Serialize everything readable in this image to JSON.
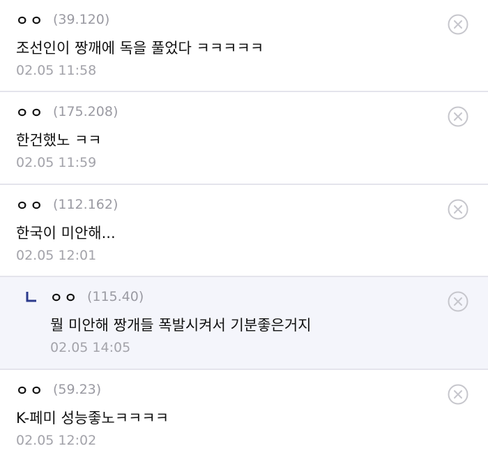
{
  "comments": [
    {
      "nickname": "ㅇㅇ",
      "ip": "(39.120)",
      "text": "조선인이 짱깨에 독을 풀었다 ㅋㅋㅋㅋㅋ",
      "date": "02.05 11:58",
      "is_reply": false
    },
    {
      "nickname": "ㅇㅇ",
      "ip": "(175.208)",
      "text": "한건했노 ㅋㅋ",
      "date": "02.05 11:59",
      "is_reply": false
    },
    {
      "nickname": "ㅇㅇ",
      "ip": "(112.162)",
      "text": "한국이 미안해...",
      "date": "02.05 12:01",
      "is_reply": false
    },
    {
      "nickname": "ㅇㅇ",
      "ip": "(115.40)",
      "text": "뭘 미안해 짱개들 폭발시켜서 기분좋은거지",
      "date": "02.05 14:05",
      "is_reply": true
    },
    {
      "nickname": "ㅇㅇ",
      "ip": "(59.23)",
      "text": "K-페미 성능좋노ㅋㅋㅋㅋ",
      "date": "02.05 12:02",
      "is_reply": false
    }
  ],
  "icons": {
    "delete": "close-circle-icon",
    "reply_marker": "reply-arrow-icon"
  },
  "colors": {
    "reply_background": "#f4f5fb",
    "reply_marker": "#2b3a8c",
    "divider": "#e4e4ec",
    "meta_text": "#a3a3aa"
  }
}
